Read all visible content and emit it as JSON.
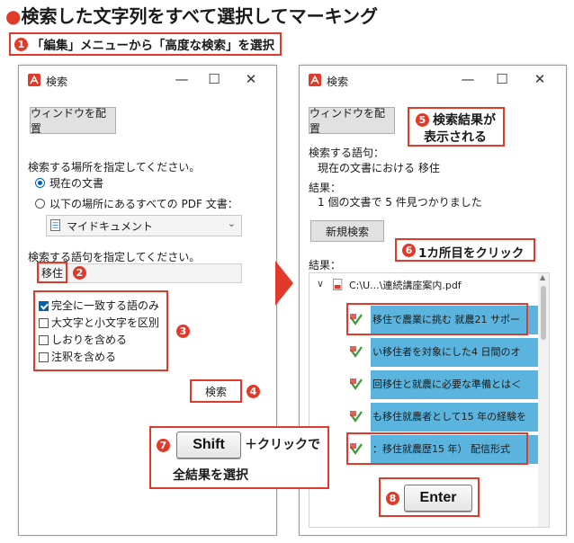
{
  "heading": {
    "bullet": "●",
    "text": "検索した文字列をすべて選択してマーキング"
  },
  "step1": {
    "num": "1",
    "text": "「編集」メニューから「高度な検索」を選択"
  },
  "left_window": {
    "title": "検索",
    "arrange_button": "ウィンドウを配置",
    "location_label": "検索する場所を指定してください。",
    "radio_current": "現在の文書",
    "radio_all_pdf": "以下の場所にあるすべての PDF 文書：",
    "location_dropdown": "マイドキュメント",
    "term_label": "検索する語句を指定してください。",
    "term_value": "移住",
    "options": [
      {
        "label": "完全に一致する語のみ",
        "checked": true
      },
      {
        "label": "大文字と小文字を区別",
        "checked": false
      },
      {
        "label": "しおりを含める",
        "checked": false
      },
      {
        "label": "注釈を含める",
        "checked": false
      }
    ],
    "search_button": "検索"
  },
  "right_window": {
    "title": "検索",
    "arrange_button": "ウィンドウを配置",
    "term_heading": "検索する語句：",
    "term_text": "現在の文書における 移住",
    "result_heading": "結果：",
    "result_summary": "1 個の文書で 5 件見つかりました",
    "new_search_button": "新規検索",
    "results_label": "結果：",
    "file_name": "C:\\U...\\連続講座案内.pdf",
    "results": [
      "移住で農業に挑む 就農21 サポー",
      "い移住者を対象にした4 日間のオ",
      "回移住と就農に必要な準備とは＜",
      "も移住就農者として15 年の経験を",
      "：移住就農歴15 年） 配信形式"
    ]
  },
  "callouts": {
    "c2": "2",
    "c3": "3",
    "c4": "4",
    "c5": {
      "num": "5",
      "line1": "検索結果が",
      "line2": "表示される"
    },
    "c6": {
      "num": "6",
      "text": "1カ所目をクリック"
    },
    "c7": {
      "num": "7",
      "key": "Shift",
      "text1": "＋クリックで",
      "text2": "全結果を選択"
    },
    "c8": {
      "num": "8",
      "key": "Enter"
    }
  },
  "window_controls": {
    "minimize": "—",
    "maximize": "☐",
    "close": "✕"
  },
  "colors": {
    "accent_red": "#e03a2a",
    "highlight_blue": "#5ab4de",
    "checkbox_blue": "#0063b1"
  }
}
